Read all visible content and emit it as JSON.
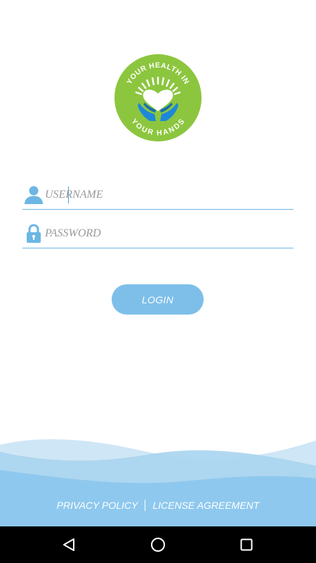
{
  "logo": {
    "text_top": "YOUR HEALTH IN",
    "text_bottom": "YOUR HANDS",
    "colors": {
      "circle": "#8cc63f",
      "hands": "#1e88d8",
      "heart": "#ffffff"
    }
  },
  "form": {
    "username_placeholder": "USERNAME",
    "password_placeholder": "PASSWORD",
    "login_label": "LOGIN",
    "icons": {
      "username": "user-icon",
      "password": "lock-icon"
    }
  },
  "footer": {
    "privacy_label": "PRIVACY POLICY",
    "license_label": "LICENSE AGREEMENT"
  },
  "navbar": {
    "back": "back-triangle-icon",
    "home": "home-circle-icon",
    "recents": "recents-square-icon"
  },
  "colors": {
    "accent": "#6cb6e4",
    "button": "#7dbfe9",
    "wave_light": "#cfe6f6",
    "wave_mid": "#a9d4f0",
    "wave_dark": "#8ec8ee"
  }
}
